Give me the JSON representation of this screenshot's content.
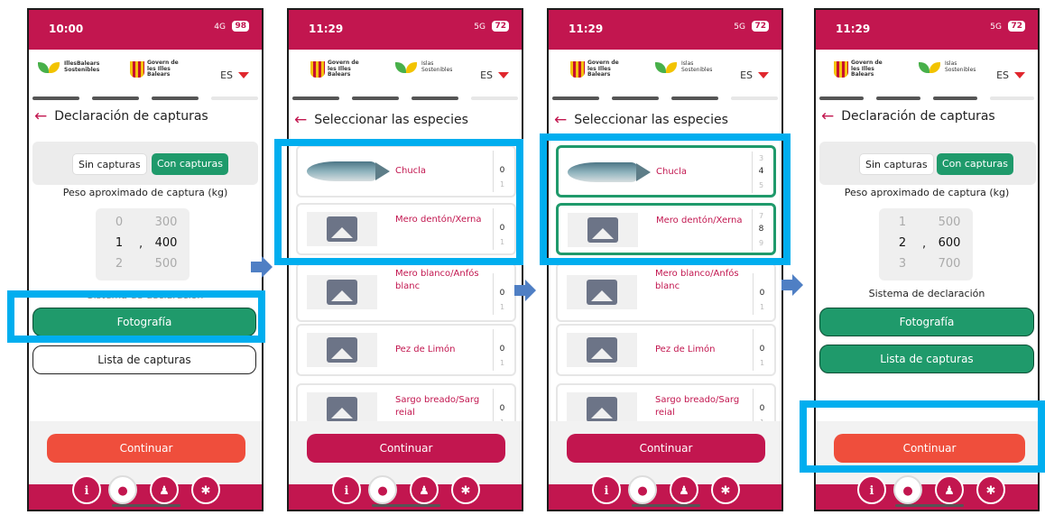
{
  "screens": [
    {
      "status": {
        "time": "10:00",
        "signal": "4G",
        "battery": "98"
      },
      "lang": "ES",
      "title": "Declaración de capturas",
      "toggle": {
        "off": "Sin capturas",
        "on": "Con capturas"
      },
      "weight_label": "Peso aproximado de captura (kg)",
      "picker": {
        "int_above": "0",
        "int_sel": "1",
        "int_below": "2",
        "dec_above": "300",
        "dec_sel": "400",
        "dec_below": "500"
      },
      "section_label": "Sistema de declaración",
      "btn_photo": "Fotografía",
      "btn_list": "Lista de capturas",
      "btn_continue": "Continuar"
    },
    {
      "status": {
        "time": "11:29",
        "signal": "5G",
        "battery": "72"
      },
      "lang": "ES",
      "title": "Seleccionar las especies",
      "species": [
        {
          "name": "Chucla",
          "above": "",
          "value": "0",
          "below": "1"
        },
        {
          "name": "Mero dentón/Xerna",
          "above": "",
          "value": "0",
          "below": "1"
        },
        {
          "name": "Mero blanco/Anfós blanc",
          "above": "",
          "value": "0",
          "below": "1"
        },
        {
          "name": "Pez de Limón",
          "above": "",
          "value": "0",
          "below": "1"
        },
        {
          "name": "Sargo breado/Sarg reial",
          "above": "",
          "value": "0",
          "below": "1"
        }
      ],
      "btn_continue": "Continuar"
    },
    {
      "status": {
        "time": "11:29",
        "signal": "5G",
        "battery": "72"
      },
      "lang": "ES",
      "title": "Seleccionar las especies",
      "species": [
        {
          "name": "Chucla",
          "above": "3",
          "value": "4",
          "below": "5"
        },
        {
          "name": "Mero dentón/Xerna",
          "above": "7",
          "value": "8",
          "below": "9"
        },
        {
          "name": "Mero blanco/Anfós blanc",
          "above": "",
          "value": "0",
          "below": "1"
        },
        {
          "name": "Pez de Limón",
          "above": "",
          "value": "0",
          "below": "1"
        },
        {
          "name": "Sargo breado/Sarg reial",
          "above": "",
          "value": "0",
          "below": "1"
        }
      ],
      "btn_continue": "Continuar"
    },
    {
      "status": {
        "time": "11:29",
        "signal": "5G",
        "battery": "72"
      },
      "lang": "ES",
      "title": "Declaración de capturas",
      "toggle": {
        "off": "Sin capturas",
        "on": "Con capturas"
      },
      "weight_label": "Peso aproximado de captura (kg)",
      "picker": {
        "int_above": "1",
        "int_sel": "2",
        "int_below": "3",
        "dec_above": "500",
        "dec_sel": "600",
        "dec_below": "700"
      },
      "section_label": "Sistema de declaración",
      "btn_photo": "Fotografía",
      "btn_list": "Lista de capturas",
      "btn_continue": "Continuar"
    }
  ],
  "logos": {
    "illes": "IllesBalears Sostenibles",
    "govern": "Govern de les Illes Balears",
    "islas": "Islas Sostenibles"
  },
  "colors": {
    "brand": "#c2164f",
    "green": "#1f9a6b",
    "continue_red": "#ef4e3c",
    "highlight": "#00aeef",
    "arrow": "#4f7fc4"
  },
  "nav_icons": [
    "info-icon",
    "fish-icon",
    "user-icon",
    "gear-icon"
  ]
}
